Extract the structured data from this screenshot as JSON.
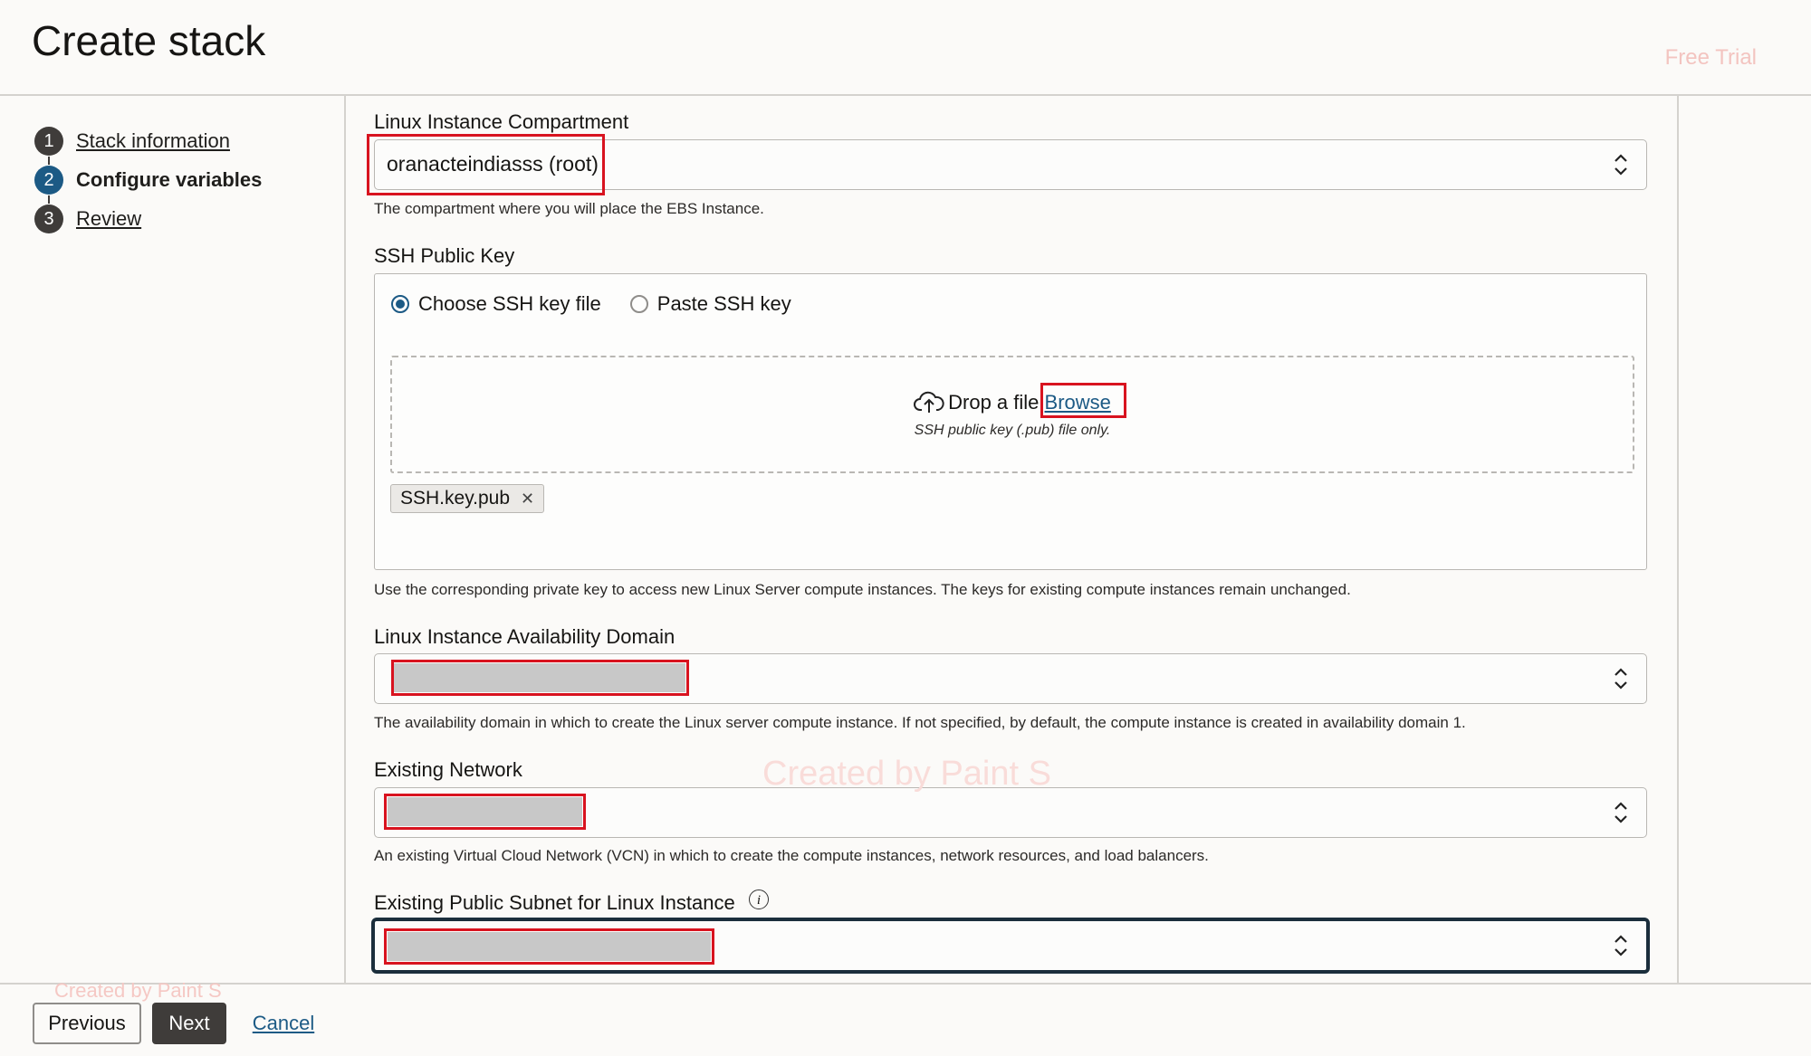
{
  "header": {
    "title": "Create stack",
    "trial_badge": "Free Trial"
  },
  "steps": [
    {
      "number": "1",
      "label": "Stack information",
      "state": "done"
    },
    {
      "number": "2",
      "label": "Configure variables",
      "state": "active"
    },
    {
      "number": "3",
      "label": "Review",
      "state": "pending"
    }
  ],
  "form": {
    "compartment": {
      "label": "Linux Instance Compartment",
      "value": "oranacteindiasss (root)",
      "help": "The compartment where you will place the EBS Instance."
    },
    "ssh": {
      "label": "SSH Public Key",
      "options": [
        "Choose SSH key file",
        "Paste SSH key"
      ],
      "selected": "Choose SSH key file",
      "drop_text": "Drop a file.",
      "browse": "Browse",
      "drop_sub": "SSH public key (.pub) file only.",
      "file_chip": "SSH.key.pub",
      "help": "Use the corresponding private key to access new Linux Server compute instances. The keys for existing compute instances remain unchanged."
    },
    "availability_domain": {
      "label": "Linux Instance Availability Domain",
      "help": "The availability domain in which to create the Linux server compute instance. If not specified, by default, the compute instance is created in availability domain 1."
    },
    "network": {
      "label": "Existing Network",
      "help": "An existing Virtual Cloud Network (VCN) in which to create the compute instances, network resources, and load balancers."
    },
    "subnet": {
      "label": "Existing Public Subnet for Linux Instance"
    }
  },
  "footer": {
    "previous": "Previous",
    "next": "Next",
    "cancel": "Cancel"
  },
  "watermarks": {
    "center": "Created by Paint S",
    "footer": "Created by Paint S"
  },
  "colors": {
    "accent": "#1c5a85",
    "highlight": "#d8131f",
    "primary_button": "#3f3c3a"
  }
}
